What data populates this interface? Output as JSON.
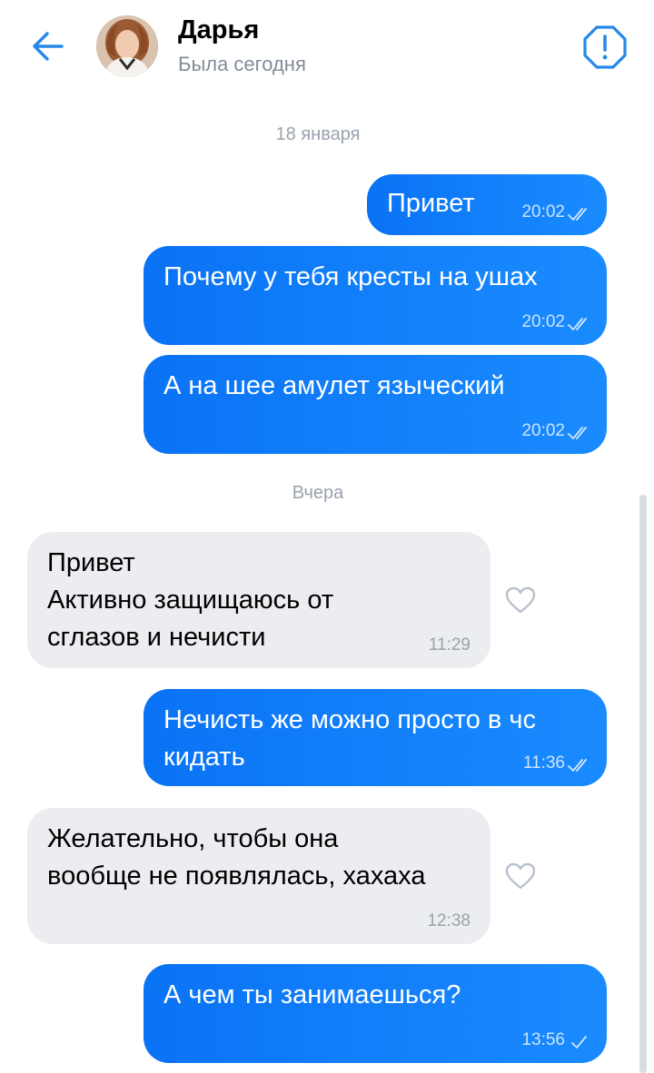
{
  "header": {
    "contact_name": "Дарья",
    "contact_status": "Была сегодня",
    "back_icon": "arrow-left-icon",
    "report_icon": "alert-octagon-icon"
  },
  "colors": {
    "accent": "#2688eb",
    "outgoing_bubble": "#0a73f5",
    "incoming_bubble": "#ebedf0",
    "secondary_text": "#818c99"
  },
  "separators": {
    "first": "18 января",
    "second": "Вчера"
  },
  "messages": [
    {
      "direction": "out",
      "text": "Привет",
      "time": "20:02",
      "status": "read"
    },
    {
      "direction": "out",
      "text": "Почему у тебя кресты на ушах",
      "time": "20:02",
      "status": "read"
    },
    {
      "direction": "out",
      "text": "А на шее амулет языческий",
      "time": "20:02",
      "status": "read"
    },
    {
      "direction": "in",
      "text": "Привет\nАктивно защищаюсь от\nсглазов и нечисти",
      "time": "11:29"
    },
    {
      "direction": "out",
      "text": "Нечисть же можно просто в чс\nкидать",
      "time": "11:36",
      "status": "read"
    },
    {
      "direction": "in",
      "text": "Желательно, чтобы она\nвообще не появлялась, хахаха",
      "time": "12:38"
    },
    {
      "direction": "out",
      "text": "А чем ты занимаешься?",
      "time": "13:56",
      "status": "sent"
    }
  ]
}
